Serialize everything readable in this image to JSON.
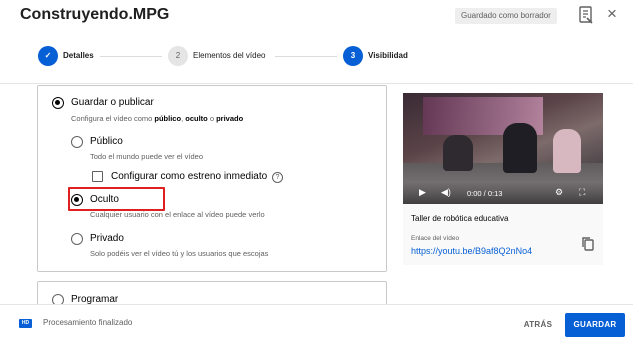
{
  "header": {
    "title": "Construyendo.MPG",
    "draft_badge": "Guardado como borrador",
    "close_icon": "×"
  },
  "stepper": {
    "steps": [
      {
        "label": "Detalles",
        "status": "done",
        "marker": "✓"
      },
      {
        "label": "Elementos del vídeo",
        "status": "pending",
        "marker": "2"
      },
      {
        "label": "Visibilidad",
        "status": "active",
        "marker": "3"
      }
    ]
  },
  "visibility": {
    "save_publish": {
      "label": "Guardar o publicar",
      "hint_prefix": "Configura el vídeo como ",
      "hint_public": "público",
      "hint_sep1": ", ",
      "hint_unlisted": "oculto",
      "hint_sep2": " o ",
      "hint_private": "privado",
      "selected": true
    },
    "options": [
      {
        "label": "Público",
        "hint": "Todo el mundo puede ver el vídeo",
        "selected": false
      },
      {
        "label": "Oculto",
        "hint": "Cualquier usuario con el enlace al vídeo puede verlo",
        "selected": true
      },
      {
        "label": "Privado",
        "hint": "Solo podéis ver el vídeo tú y los usuarios que escojas",
        "selected": false
      }
    ],
    "premiere": {
      "label": "Configurar como estreno inmediato",
      "checked": false,
      "help_icon": "?"
    },
    "schedule": {
      "label": "Programar",
      "selected": false
    }
  },
  "preview": {
    "time": "0:00 / 0:13",
    "video_title": "Taller de robótica educativa",
    "link_label": "Enlace del vídeo",
    "link": "https://youtu.be/B9af8Q2nNo4"
  },
  "footer": {
    "hd_badge": "HD",
    "status": "Procesamiento finalizado",
    "back_label": "ATRÁS",
    "save_label": "GUARDAR"
  },
  "colors": {
    "accent": "#065fd4",
    "highlight": "#e02020"
  }
}
